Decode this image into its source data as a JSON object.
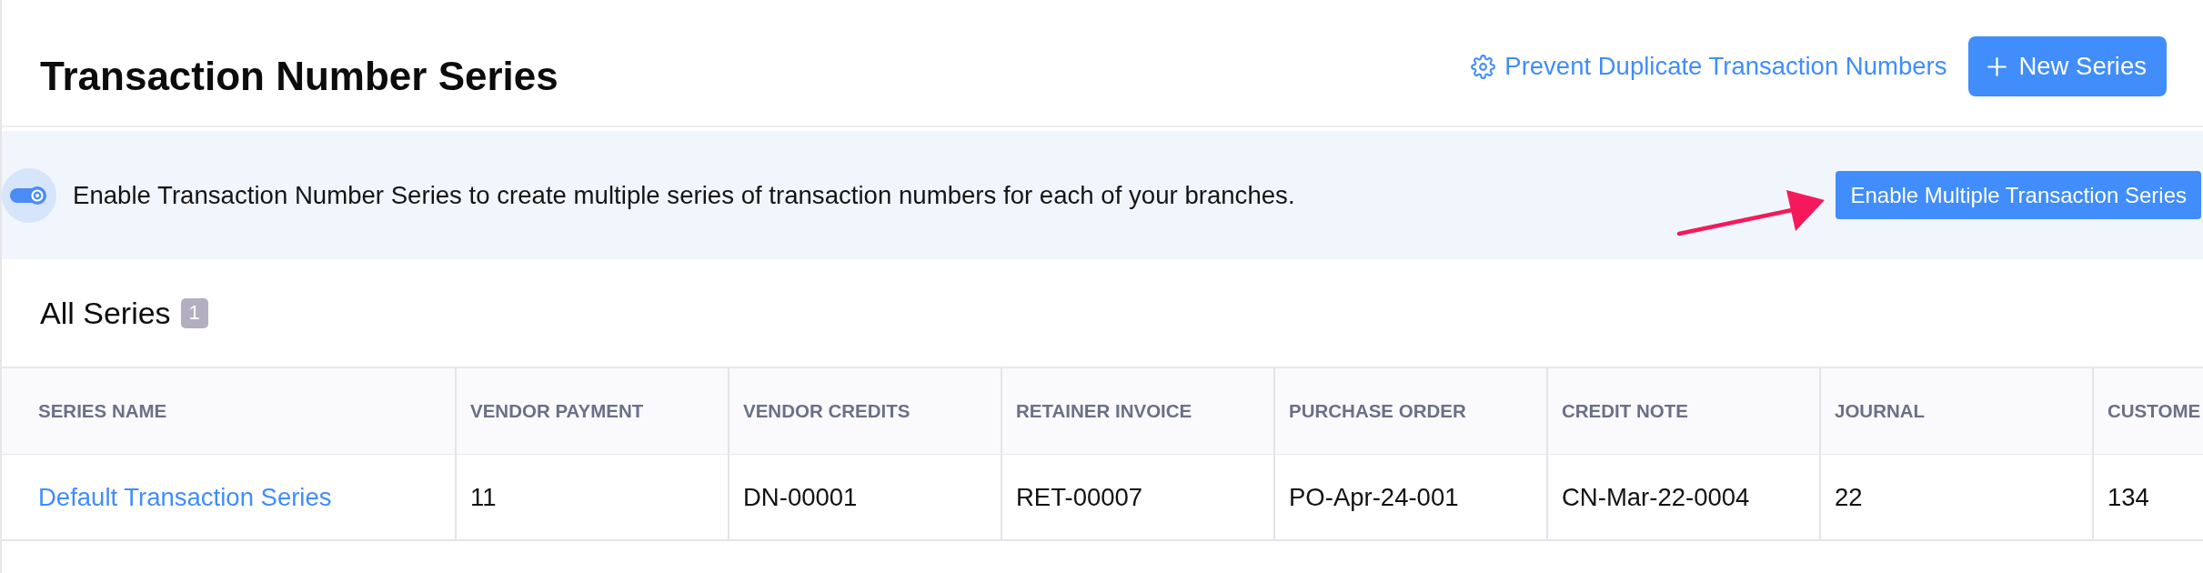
{
  "header": {
    "title": "Transaction Number Series",
    "settings_link": "Prevent Duplicate Transaction Numbers",
    "new_button": "New Series"
  },
  "banner": {
    "message": "Enable Transaction Number Series to create multiple series of transaction numbers for each of your branches.",
    "button": "Enable Multiple Transaction Series"
  },
  "section": {
    "title": "All Series",
    "count": "1"
  },
  "table": {
    "columns": [
      "SERIES NAME",
      "VENDOR PAYMENT",
      "VENDOR CREDITS",
      "RETAINER INVOICE",
      "PURCHASE ORDER",
      "CREDIT NOTE",
      "JOURNAL",
      "CUSTOME"
    ],
    "rows": [
      {
        "series_name": "Default Transaction Series",
        "values": [
          "11",
          "DN-00001",
          "RET-00007",
          "PO-Apr-24-001",
          "CN-Mar-22-0004",
          "22",
          "134"
        ]
      }
    ]
  }
}
